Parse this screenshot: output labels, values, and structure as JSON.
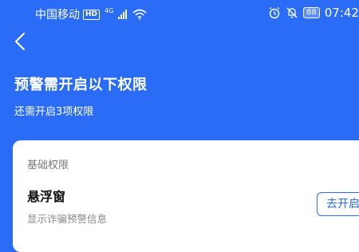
{
  "status_bar": {
    "carrier": "中国移动",
    "hd_label": "HD",
    "network_gen": "4G",
    "battery": "88",
    "time": "07:42"
  },
  "header": {
    "title": "预警需开启以下权限",
    "subtitle": "还需开启3项权限"
  },
  "card": {
    "section_label": "基础权限",
    "permission": {
      "name": "悬浮窗",
      "description": "显示诈骗预警信息",
      "button_label": "去开启"
    }
  },
  "colors": {
    "primary": "#2a6cf6",
    "card_bg": "#ffffff",
    "muted_text": "#888888"
  },
  "icons": [
    "hd-icon",
    "signal-icon",
    "wifi-icon",
    "alarm-icon",
    "mute-icon",
    "battery-icon",
    "back-arrow-icon"
  ]
}
